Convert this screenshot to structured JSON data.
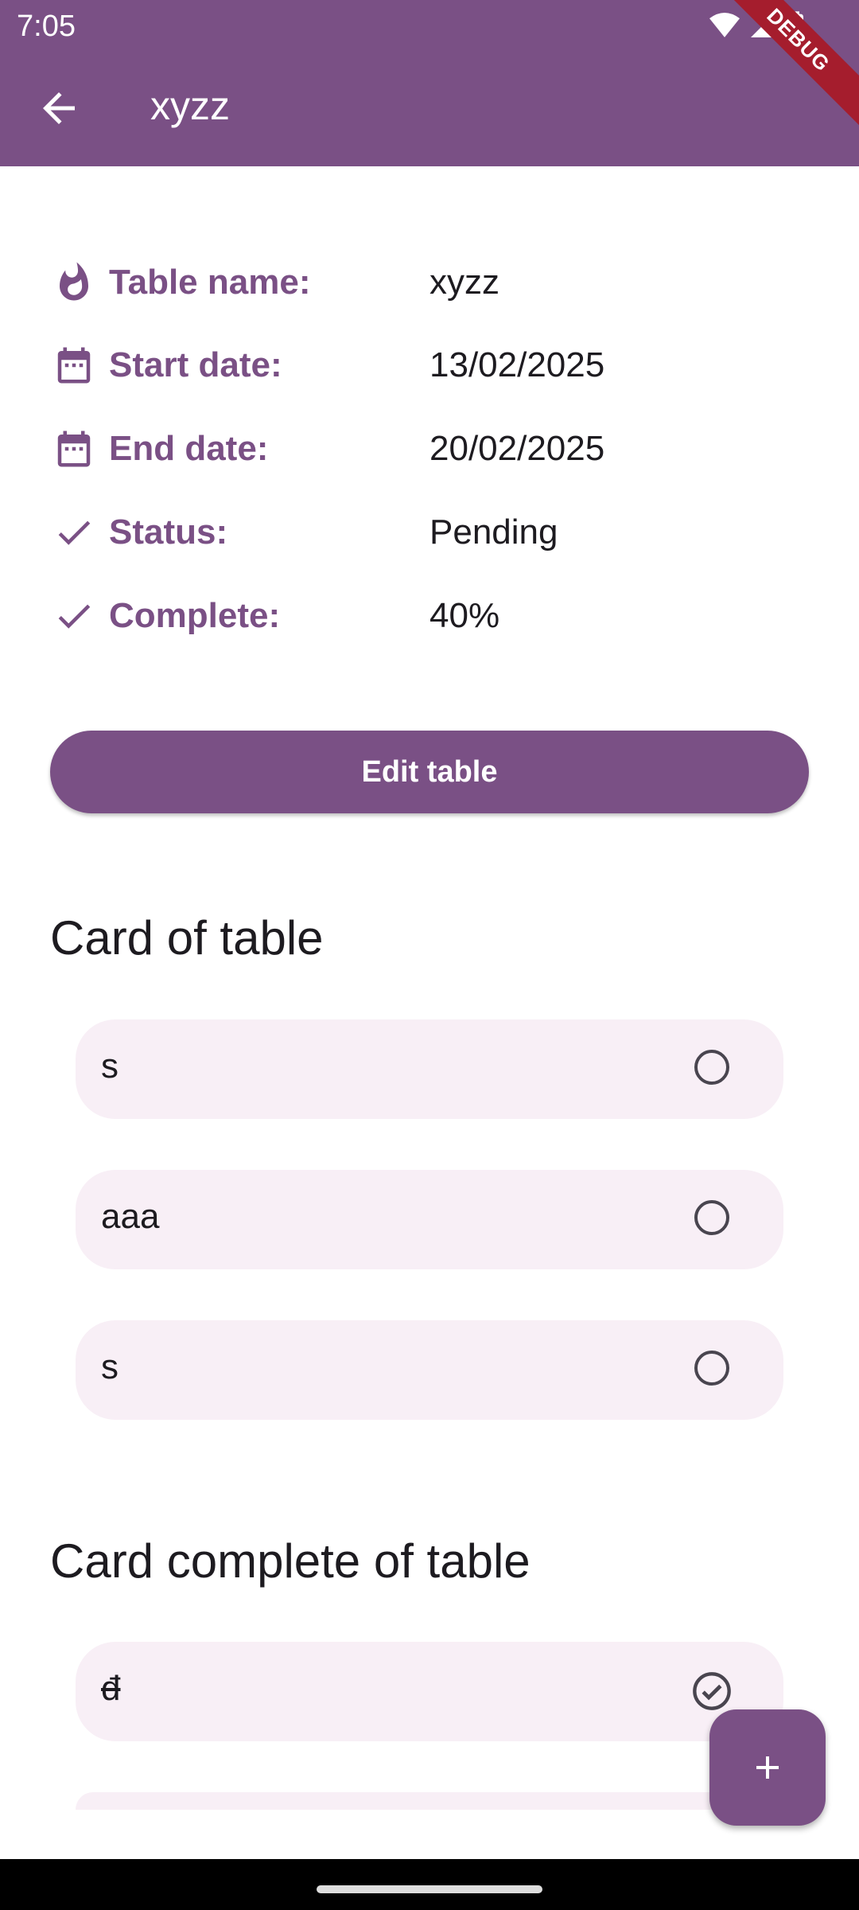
{
  "status_bar": {
    "time": "7:05",
    "debug_label": "DEBUG"
  },
  "app_bar": {
    "title": "xyzz"
  },
  "info": [
    {
      "icon": "fire-icon",
      "label": "Table name:",
      "value": "xyzz"
    },
    {
      "icon": "calendar-icon",
      "label": "Start date:",
      "value": "13/02/2025"
    },
    {
      "icon": "calendar-icon",
      "label": "End date:",
      "value": "20/02/2025"
    },
    {
      "icon": "check-icon",
      "label": "Status:",
      "value": "Pending"
    },
    {
      "icon": "check-icon",
      "label": "Complete:",
      "value": "40%"
    }
  ],
  "edit_button": {
    "label": "Edit table"
  },
  "cards_section": {
    "title": "Card of table",
    "items": [
      {
        "text": "s",
        "checked": false
      },
      {
        "text": "aaa",
        "checked": false
      },
      {
        "text": "s",
        "checked": false
      }
    ]
  },
  "complete_section": {
    "title": "Card complete of table",
    "items": [
      {
        "text": "đ",
        "checked": true
      }
    ]
  },
  "colors": {
    "primary": "#7a5085",
    "card_bg": "#f8eff6"
  }
}
